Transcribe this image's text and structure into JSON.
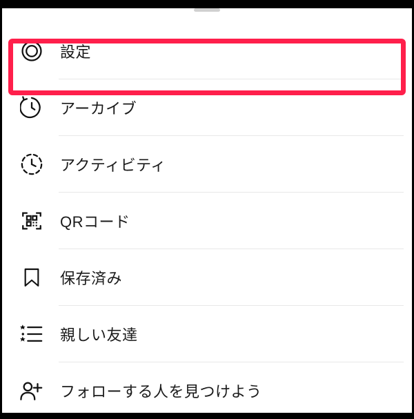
{
  "menu": {
    "items": [
      {
        "key": "settings",
        "label": "設定",
        "icon": "settings-icon"
      },
      {
        "key": "archive",
        "label": "アーカイブ",
        "icon": "archive-icon"
      },
      {
        "key": "activity",
        "label": "アクティビティ",
        "icon": "activity-icon"
      },
      {
        "key": "qrcode",
        "label": "QRコード",
        "icon": "qrcode-icon"
      },
      {
        "key": "saved",
        "label": "保存済み",
        "icon": "saved-icon"
      },
      {
        "key": "close-friends",
        "label": "親しい友達",
        "icon": "close-friends-icon"
      },
      {
        "key": "discover",
        "label": "フォローする人を見つけよう",
        "icon": "discover-icon"
      }
    ]
  },
  "highlight": {
    "index": 0,
    "color": "#ff1f4b"
  }
}
